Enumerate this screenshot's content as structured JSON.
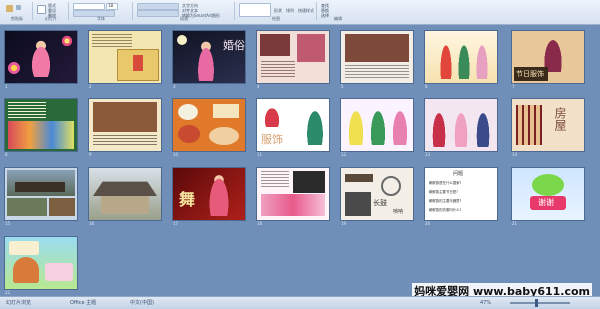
{
  "ribbon": {
    "groups": [
      "剪贴板",
      "幻灯片",
      "字体",
      "段落",
      "绘图",
      "编辑"
    ],
    "font_size_value": "18",
    "items": [
      "版式",
      "重设",
      "删除",
      "文字方向",
      "对齐文本",
      "转换为SmartArt图形",
      "形状",
      "排列",
      "快速样式",
      "查找",
      "替换",
      "选择"
    ]
  },
  "slides": [
    {
      "num": "1",
      "text": ""
    },
    {
      "num": "2",
      "text": ""
    },
    {
      "num": "3",
      "text": "婚俗"
    },
    {
      "num": "4",
      "text": ""
    },
    {
      "num": "5",
      "text": ""
    },
    {
      "num": "6",
      "text": ""
    },
    {
      "num": "7",
      "text": "节日服饰"
    },
    {
      "num": "8",
      "text": ""
    },
    {
      "num": "9",
      "text": ""
    },
    {
      "num": "10",
      "text": ""
    },
    {
      "num": "11",
      "text": "服饰"
    },
    {
      "num": "12",
      "text": ""
    },
    {
      "num": "13",
      "text": ""
    },
    {
      "num": "14",
      "text": "房屋"
    },
    {
      "num": "15",
      "text": ""
    },
    {
      "num": "16",
      "text": ""
    },
    {
      "num": "17",
      "text": "舞"
    },
    {
      "num": "18",
      "text": ""
    },
    {
      "num": "19",
      "text": "长鼓"
    },
    {
      "num": "20",
      "text": "问题"
    },
    {
      "num": "21",
      "text": "谢谢"
    },
    {
      "num": "22",
      "text": ""
    }
  ],
  "slide20_lines": [
    "朝鲜族是在什么国家?",
    "朝鲜族主要节日是?",
    "朝鲜族的主要乐器是?",
    "朝鲜族的衣服叫什么?"
  ],
  "slide19_extra": "唢呐",
  "statusbar": {
    "left": "幻灯片浏览",
    "theme": "Office 主题",
    "lang": "中文(中国)",
    "zoom": "47%"
  },
  "watermark": "妈咪爱婴网 www.baby611.com",
  "colors": {
    "app_bg": "#6f8fb9",
    "ribbon_bg": "#dfe8f4"
  }
}
